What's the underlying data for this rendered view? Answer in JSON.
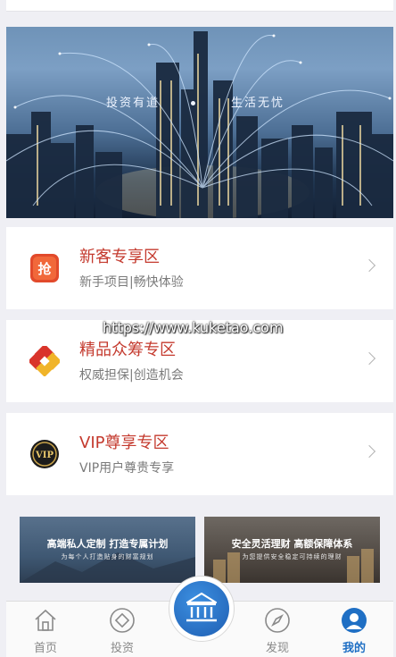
{
  "banner": {
    "slogan_left": "投资有道",
    "slogan_right": "生活无忧"
  },
  "cards": [
    {
      "title": "新客专享区",
      "subtitle": "新手项目|畅快体验",
      "icon": "grab-icon",
      "icon_text": "抢"
    },
    {
      "title": "精品众筹专区",
      "subtitle": "权威担保|创造机会",
      "icon": "diamond-knot-icon"
    },
    {
      "title": "VIP尊享专区",
      "subtitle": "VIP用户尊贵专享",
      "icon": "vip-badge-icon",
      "icon_text": "VIP"
    }
  ],
  "watermark": "https://www.kuketao.com",
  "promos": [
    {
      "title": "高端私人定制 打造专属计划",
      "subtitle": "为每个人打造贴身的财富规划"
    },
    {
      "title": "安全灵活理财 高额保障体系",
      "subtitle": "为您提供安全稳定可持续的理财"
    }
  ],
  "tabs": [
    {
      "label": "首页",
      "icon": "home-icon",
      "active": false
    },
    {
      "label": "投资",
      "icon": "invest-diamond-icon",
      "active": false
    },
    {
      "label": "发现",
      "icon": "compass-icon",
      "active": false
    },
    {
      "label": "我的",
      "icon": "user-icon",
      "active": true
    }
  ],
  "center_button": {
    "icon": "bank-icon"
  },
  "colors": {
    "accent_blue": "#1f6fc4",
    "title_red": "#c43a2e",
    "background": "#efeff4"
  }
}
